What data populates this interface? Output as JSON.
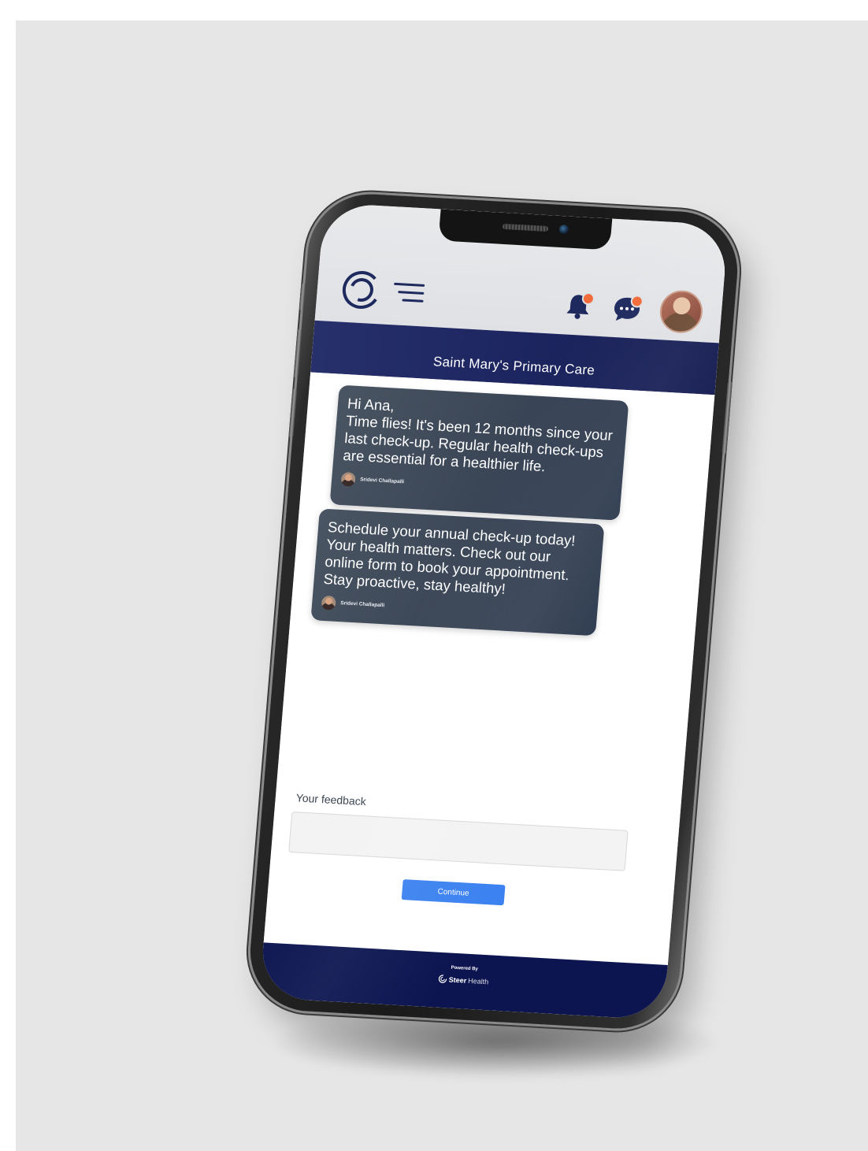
{
  "header": {
    "logo_icon": "steer-health-logo-icon",
    "menu_icon": "hamburger-menu-icon",
    "notification_icon": "bell-icon",
    "messages_icon": "chat-bubble-icon",
    "badge_color": "#f26b3a",
    "avatar": "user-avatar"
  },
  "banner": {
    "title": "Saint Mary's Primary Care",
    "color": "#1d2660"
  },
  "messages": [
    {
      "lines": [
        "Hi Ana,",
        "Time flies! It's been 12 months since your",
        "last check-up. Regular health check-ups",
        "are essential for a healthier life."
      ],
      "author": "Sridevi Challapalli"
    },
    {
      "lines": [
        "Schedule your annual check-up today!",
        "Your health matters. Check out our",
        "online form to book your appointment.",
        "Stay proactive, stay healthy!"
      ],
      "author": "Sridevi Challapalli"
    }
  ],
  "feedback": {
    "label": "Your feedback",
    "value": ""
  },
  "continue_button": {
    "label": "Continue",
    "color": "#3c82f0"
  },
  "footer": {
    "powered_by": "Powered By",
    "brand_strong": "Steer",
    "brand_light": "Health",
    "color": "#0c1550"
  }
}
